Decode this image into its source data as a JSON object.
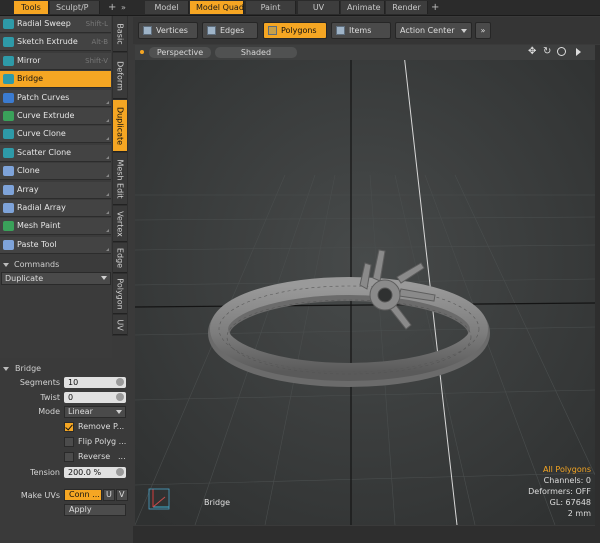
{
  "top_tabs": {
    "left": [
      "Tools",
      "Sculpt/P"
    ],
    "right": [
      "Model",
      "Model Quad",
      "Paint",
      "UV",
      "Animate",
      "Render"
    ],
    "plus": "+",
    "more": "»"
  },
  "tools": [
    {
      "label": "Radial Sweep",
      "shortcut": "Shift-L",
      "icon": "radial-sweep-icon",
      "color": "#2e9aa8"
    },
    {
      "label": "Sketch Extrude",
      "shortcut": "Alt-B",
      "icon": "sketch-extrude-icon",
      "color": "#2e9aa8"
    },
    {
      "label": "Mirror",
      "shortcut": "Shift-V",
      "icon": "mirror-icon",
      "color": "#2e9aa8"
    },
    {
      "label": "Bridge",
      "shortcut": "",
      "icon": "bridge-icon",
      "color": "#2e9aa8"
    },
    {
      "label": "Patch Curves",
      "shortcut": "",
      "icon": "patch-curves-icon",
      "color": "#3b7bd0"
    },
    {
      "label": "Curve Extrude",
      "shortcut": "",
      "icon": "curve-extrude-icon",
      "color": "#3aa15a"
    },
    {
      "label": "Curve Clone",
      "shortcut": "",
      "icon": "curve-clone-icon",
      "color": "#2e9aa8"
    },
    {
      "label": "Scatter Clone",
      "shortcut": "",
      "icon": "scatter-clone-icon",
      "color": "#2e9aa8"
    },
    {
      "label": "Clone",
      "shortcut": "",
      "icon": "clone-icon",
      "color": "#7ea3d9"
    },
    {
      "label": "Array",
      "shortcut": "",
      "icon": "array-icon",
      "color": "#7ea3d9"
    },
    {
      "label": "Radial Array",
      "shortcut": "",
      "icon": "radial-array-icon",
      "color": "#7ea3d9"
    },
    {
      "label": "Mesh Paint",
      "shortcut": "",
      "icon": "mesh-paint-icon",
      "color": "#3aa15a"
    },
    {
      "label": "Paste Tool",
      "shortcut": "",
      "icon": "paste-tool-icon",
      "color": "#7ea3d9"
    }
  ],
  "vertical_tabs": [
    "Basic",
    "Deform",
    "Duplicate",
    "Mesh Edit",
    "Vertex",
    "Edge",
    "Polygon",
    "UV"
  ],
  "commands": {
    "header": "Commands",
    "value": "Duplicate"
  },
  "props": {
    "header": "Bridge",
    "segments_label": "Segments",
    "segments": "10",
    "twist_label": "Twist",
    "twist": "0",
    "mode_label": "Mode",
    "mode": "Linear",
    "remove_label": "Remove P...",
    "flip_label": "Flip Polyg ...",
    "reverse_label": "Reverse",
    "reverse_more": "...",
    "tension_label": "Tension",
    "tension": "200.0 %",
    "make_uvs_label": "Make UVs",
    "make_uvs": "Conn ...",
    "u": "U",
    "v": "V",
    "apply": "Apply"
  },
  "modes": [
    {
      "label": "Vertices"
    },
    {
      "label": "Edges"
    },
    {
      "label": "Polygons"
    },
    {
      "label": "Items"
    }
  ],
  "action_center": "Action Center",
  "viewport": {
    "view": "Perspective",
    "shading": "Shaded",
    "tool_label": "Bridge",
    "status": [
      "All Polygons",
      "Channels: 0",
      "Deformers: OFF",
      "GL: 67648",
      "2 mm"
    ]
  },
  "colors": {
    "accent": "#f5a623",
    "status_highlight": "#f5a623"
  }
}
